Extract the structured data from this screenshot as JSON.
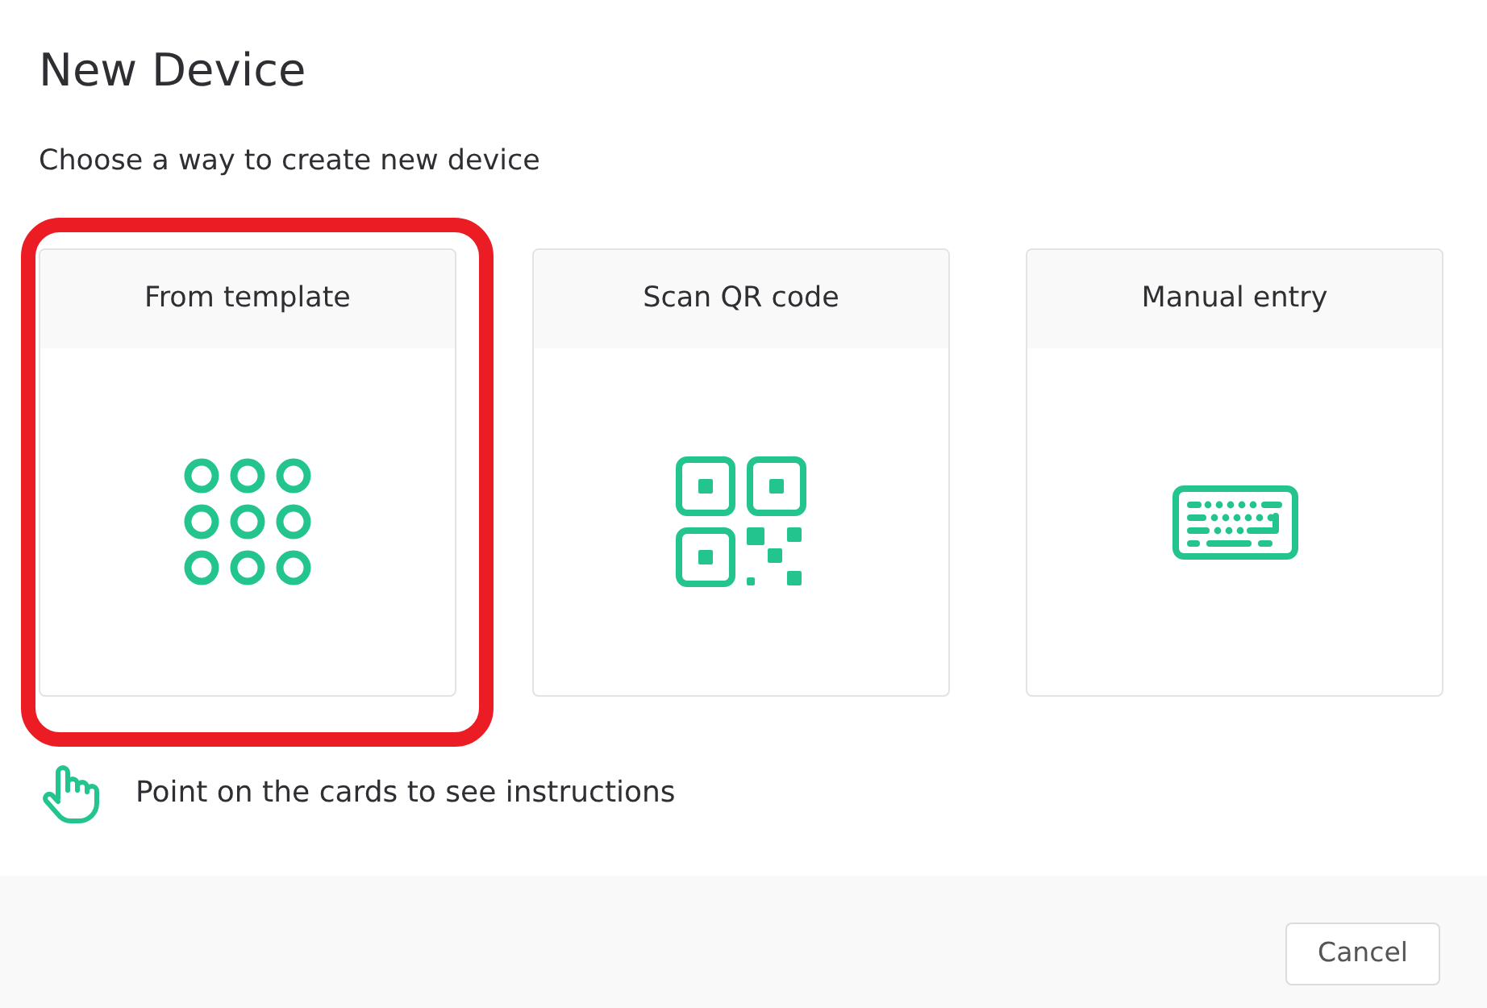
{
  "dialog": {
    "title": "New Device",
    "subtitle": "Choose a way to create new device"
  },
  "options": [
    {
      "kind": "template",
      "label": "From template",
      "highlighted": true
    },
    {
      "kind": "qr",
      "label": "Scan QR code",
      "highlighted": false
    },
    {
      "kind": "manual",
      "label": "Manual entry",
      "highlighted": false
    }
  ],
  "hint": {
    "text": "Point on the cards to see instructions"
  },
  "footer": {
    "buttons": [
      "Cancel"
    ]
  }
}
